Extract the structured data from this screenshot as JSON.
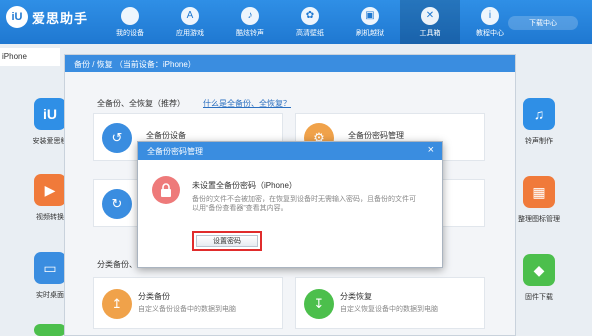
{
  "app": {
    "logo_mark": "iU",
    "name": "爱思助手",
    "download_center": "下载中心"
  },
  "nav": [
    {
      "label": "我的设备",
      "icon": "apple-icon",
      "glyph": ""
    },
    {
      "label": "应用游戏",
      "icon": "app-store-icon",
      "glyph": "A"
    },
    {
      "label": "酷炫铃声",
      "icon": "bell-icon",
      "glyph": "♪"
    },
    {
      "label": "高清壁纸",
      "icon": "flower-icon",
      "glyph": "✿"
    },
    {
      "label": "刷机越狱",
      "icon": "box-icon",
      "glyph": "▣"
    },
    {
      "label": "工具箱",
      "icon": "wrench-icon",
      "glyph": "✕"
    },
    {
      "label": "教程中心",
      "icon": "info-icon",
      "glyph": "i"
    }
  ],
  "device_tab": "iPhone",
  "left_tiles": [
    {
      "label": "安装爱思移",
      "glyph": "iU",
      "color": "#2f8fe6",
      "icon": "aisi-icon"
    },
    {
      "label": "视频转换",
      "glyph": "▶",
      "color": "#f07a3a",
      "icon": "video-icon"
    },
    {
      "label": "实时桌面",
      "glyph": "▭",
      "color": "#3a8de0",
      "icon": "screen-icon"
    }
  ],
  "right_tiles": [
    {
      "label": "铃声制作",
      "glyph": "♫",
      "color": "#2f8fe6",
      "icon": "ringtone-icon"
    },
    {
      "label": "整理图标管理",
      "glyph": "▦",
      "color": "#f07a3a",
      "icon": "grid-icon"
    },
    {
      "label": "固件下载",
      "glyph": "◆",
      "color": "#4cbf4c",
      "icon": "firmware-icon"
    }
  ],
  "panel": {
    "title": "备份 / 恢复 （当前设备：iPhone）",
    "section1_title": "全备份、全恢复（推荐）",
    "section1_link": "什么是全备份、全恢复？",
    "section2_title": "分类备份、",
    "cards": [
      {
        "title": "全备份设备",
        "desc": "",
        "glyph": "↺",
        "color": "#3a8de0",
        "icon": "backup-icon"
      },
      {
        "title": "全备份密码管理",
        "desc": "",
        "glyph": "⚙",
        "color": "#f0a24a",
        "icon": "password-icon"
      },
      {
        "title": "",
        "desc": "",
        "glyph": "↻",
        "color": "#3a8de0",
        "icon": "restore-icon"
      },
      {
        "title": "分类备份",
        "desc": "自定义备份设备中的数据到电脑",
        "glyph": "↥",
        "color": "#f0a24a",
        "icon": "category-backup-icon"
      },
      {
        "title": "分类恢复",
        "desc": "自定义恢复设备中的数据到电脑",
        "glyph": "↧",
        "color": "#4cbf4c",
        "icon": "category-restore-icon"
      }
    ]
  },
  "dialog": {
    "title": "全备份密码管理",
    "heading": "未设置全备份密码（iPhone）",
    "message": "备份的文件不会被加密，在恢复到设备时无需输入密码，且备份的文件可以用“备份查看器”查看其内容。",
    "button": "设置密码",
    "close": "×"
  }
}
